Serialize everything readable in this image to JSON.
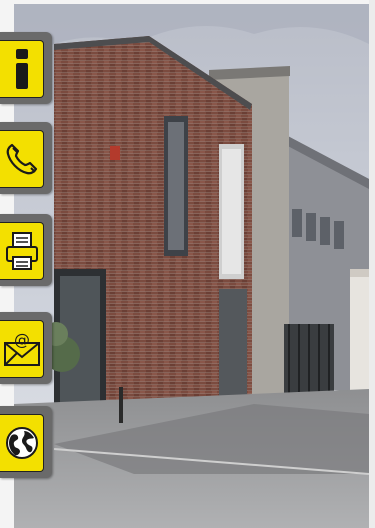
{
  "colors": {
    "tile_outer": "#6a6a6a",
    "tile_inner": "#f3e000",
    "icon": "#1a1a1a",
    "sky": "#c7ccd6",
    "brick": "#7a4a3e"
  },
  "sidebar": {
    "items": [
      {
        "icon": "info-icon",
        "action": "info"
      },
      {
        "icon": "phone-icon",
        "action": "phone"
      },
      {
        "icon": "fax-icon",
        "action": "fax"
      },
      {
        "icon": "email-icon",
        "action": "email"
      },
      {
        "icon": "globe-icon",
        "action": "web"
      }
    ]
  }
}
